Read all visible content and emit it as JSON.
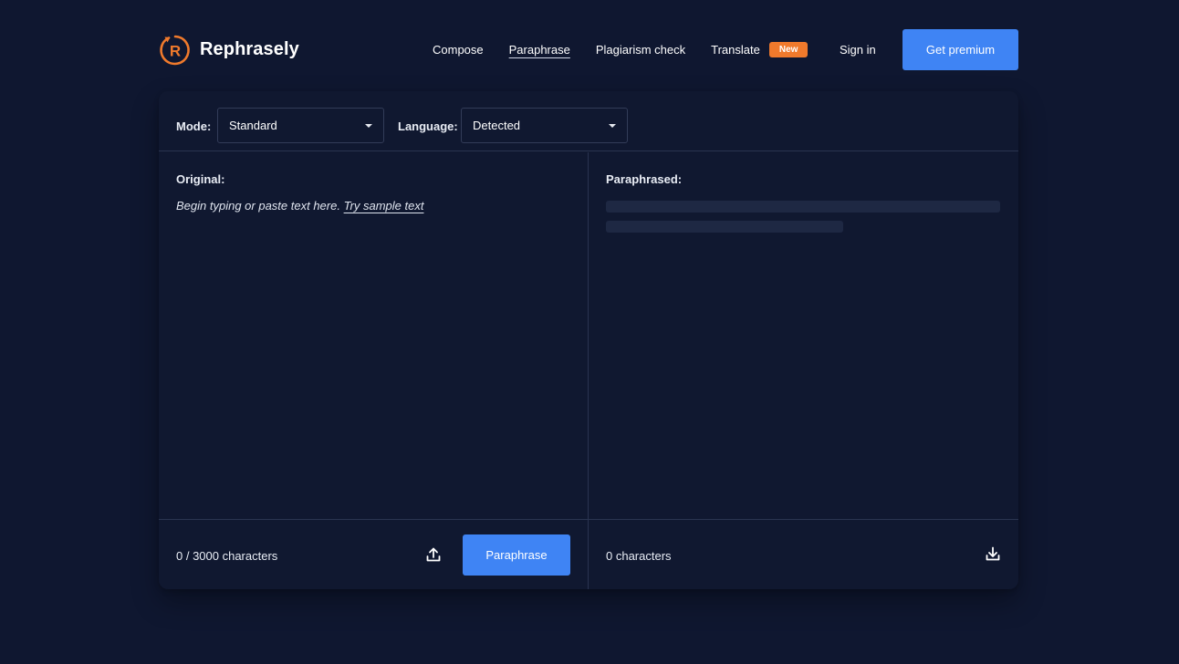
{
  "brand": {
    "logo_letter": "R",
    "name": "Rephrasely",
    "accent_color": "#f07a2c"
  },
  "nav": {
    "items": [
      {
        "label": "Compose",
        "active": false
      },
      {
        "label": "Paraphrase",
        "active": true
      },
      {
        "label": "Plagiarism check",
        "active": false
      },
      {
        "label": "Translate",
        "active": false
      }
    ],
    "translate_badge": "New",
    "sign_in": "Sign in",
    "premium_button": "Get premium",
    "primary_color": "#3f84f4"
  },
  "toolbar": {
    "mode_label": "Mode:",
    "mode_value": "Standard",
    "language_label": "Language:",
    "language_value": "Detected"
  },
  "original": {
    "title": "Original:",
    "placeholder_prefix": "Begin typing or paste text here.",
    "sample_link": "Try sample text",
    "char_count": "0 / 3000 characters",
    "upload_icon": "upload-icon",
    "paraphrase_button": "Paraphrase"
  },
  "paraphrased": {
    "title": "Paraphrased:",
    "char_count": "0 characters",
    "download_icon": "download-icon"
  }
}
